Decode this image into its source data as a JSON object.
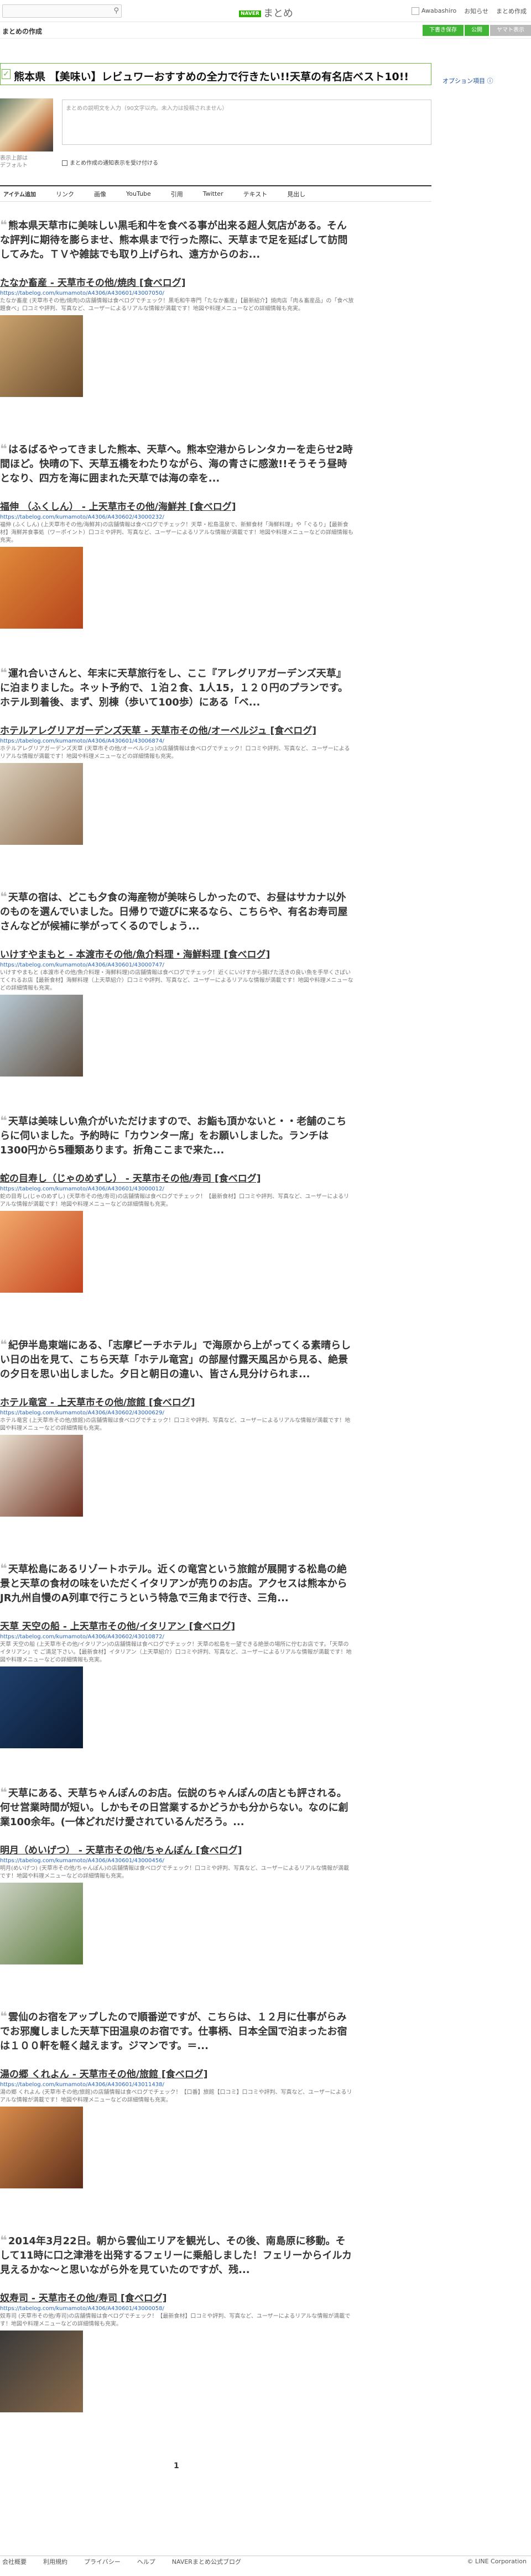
{
  "header": {
    "search_placeholder": "",
    "logo_naver": "NAVER",
    "logo_text": "まとめ",
    "user_name": "Awabashiro",
    "notices": "お知らせ",
    "matome_menu": "まとめ作成"
  },
  "subbar": {
    "title": "まとめの作成",
    "buttons": [
      "下書き保存",
      "公開",
      "ヤマト表示"
    ]
  },
  "matome": {
    "check": "✓",
    "title": "熊本県 【美味い】レビュワーおすすめの全力で行きたい!!天草の有名店ベスト10!!",
    "option": "オプション項目 ⓘ",
    "thumb_caption": [
      "表示上部は",
      "デフォルト"
    ],
    "comment_placeholder": "まとめの説明文を入力（90文字以内。未入力は投稿されません）",
    "notify_label": "まとめ作成の通知表示を受け付ける"
  },
  "add_bar": [
    "アイテム追加",
    "リンク",
    "画像",
    "YouTube",
    "引用",
    "Twitter",
    "テキスト",
    "見出し"
  ],
  "items": [
    {
      "quote": "熊本県天草市に美味しい黒毛和牛を食べる事が出来る超人気店がある。そんな評判に期待を膨らませ、熊本県まで行った際に、天草まで足を延ばして訪問してみた。ＴＶや雑誌でも取り上げられ、遠方からのお...",
      "title": "たなか畜産 - 天草市その他/焼肉 [食べログ]",
      "url": "https://tabelog.com/kumamoto/A4306/A430601/43007050/",
      "desc": "たなか畜産 (天草市その他/焼肉)の店舗情報は食べログでチェック！黒毛和牛専門「たなか畜産」【最新紹介】焼肉店「肉＆畜産品」の「食べ放題食べ」口コミや評判、写真など、ユーザーによるリアルな情報が満載です！地図や料理メニューなどの詳細情報も充実。",
      "photo": [
        "#c9a26d",
        "#6b4b2c"
      ]
    },
    {
      "quote": "はるばるやってきました熊本、天草へ。熊本空港からレンタカーを走らせ2時間ほど。快晴の下、天草五橋をわたりながら、海の青さに感激!!そうそう昼時となり、四方を海に囲まれた天草では海の幸を...",
      "title": "福伸 （ふくしん） - 上天草市その他/海鮮丼 [食べログ]",
      "url": "https://tabelog.com/kumamoto/A4306/A430602/43000232/",
      "desc": "福伸 (ふくしん) (上天草市その他/海鮮丼)の店舗情報は食べログでチェック！天草・松島温泉で、新鮮食材「海鮮料理」や「ぐるり」【最新食材】海鮮丼食事処（ワーポイント）口コミや評判、写真など、ユーザーによるリアルな情報が満載です！地図や料理メニューなどの詳細情報も充実。",
      "photo": [
        "#e08a3a",
        "#b5441c"
      ]
    },
    {
      "quote": "運れ合いさんと、年末に天草旅行をし、ここ『アレグリアガーデンズ天草』に泊まりました。ネット予約で、１泊２食、1人15，１２０円のプランです。ホテル到着後、まず、別棟（歩いて100歩）にある「ベ...",
      "title": "ホテルアレグリアガーデンズ天草 - 天草市その他/オーベルジュ [食べログ]",
      "url": "https://tabelog.com/kumamoto/A4306/A430601/43006874/",
      "desc": "ホテルアレグリアガーデンズ天草 (天草市その他/オーベルジュ)の店舗情報は食べログでチェック！口コミや評判、写真など、ユーザーによるリアルな情報が満載です！地図や料理メニューなどの詳細情報も充実。",
      "photo": [
        "#d8ccb8",
        "#8c6a4c"
      ]
    },
    {
      "quote": "天草の宿は、どこも夕食の海産物が美味らしかったので、お昼はサカナ以外のものを選んでいました。日帰りで遊びに来るなら、こちらや、有名お寿司屋さんなどが候補に挙がってくるのでしょう...",
      "title": "いけすやまもと - 本渡市その他/魚介料理・海鮮料理 [食べログ]",
      "url": "https://tabelog.com/kumamoto/A4306/A430601/43000747/",
      "desc": "いけすやまもと (本渡市その他/魚介料理・海鮮料理)の店舗情報は食べログでチェック！近くにいけすから揚げた活きの良い魚を手早くさばいてくれるお店【最新食材】海鮮料理（上天草紹介）口コミや評判、写真など、ユーザーによるリアルな情報が満載です！地図や料理メニューなどの詳細情報も充実。",
      "photo": [
        "#b7c9d4",
        "#5c4a3a"
      ]
    },
    {
      "quote": "天草は美味しい魚介がいただけますので、お鮨も頂かないと・・老舗のこちらに伺いました。予約時に「カウンター席」をお願いしました。ランチは1300円から5種類あります。折角ここまで来た...",
      "title": "蛇の目寿し（じゃのめずし） - 天草市その他/寿司 [食べログ]",
      "url": "https://tabelog.com/kumamoto/A4306/A430601/43000012/",
      "desc": "蛇の目寿し(じゃのめずし) (天草市その他/寿司)の店舗情報は食べログでチェック！【最新食材】口コミや評判、写真など、ユーザーによるリアルな情報が満載です！地図や料理メニューなどの詳細情報も充実。",
      "photo": [
        "#f2a86b",
        "#c2421e"
      ]
    },
    {
      "quote": "紀伊半島東端にある、「志摩ビーチホテル」で海原から上がってくる素晴らしい日の出を見て、こちら天草「ホテル竜宮」の部屋付露天風呂から見る、絶景の夕日を思い出しました。夕日と朝日の違い、皆さん見分けられま...",
      "title": "ホテル竜宮 - 上天草市その他/旅館 [食べログ]",
      "url": "https://tabelog.com/kumamoto/A4306/A430602/43000629/",
      "desc": "ホテル竜宮 (上天草市その他/旅館)の店舗情報は食べログでチェック！口コミや評判、写真など、ユーザーによるリアルな情報が満載です！地図や料理メニューなどの詳細情報も充実。",
      "photo": [
        "#e9dfcf",
        "#6d2f1f"
      ]
    },
    {
      "quote": "天草松島にあるリゾートホテル。近くの竜宮という旅館が展開する松島の絶景と天草の食材の味をいただくイタリアンが売りのお店。アクセスは熊本からJR九州自慢のA列車で行こうという特急で三角まで行き、三角...",
      "title": "天草 天空の船 - 上天草市その他/イタリアン [食べログ]",
      "url": "https://tabelog.com/kumamoto/A4306/A430602/43010872/",
      "desc": "天草 天空の船 (上天草市その他/イタリアン)の店舗情報は食べログでチェック！天草の松島を一望できる絶景の場所に佇むお店です。「天草のイタリアン」で ご満足下さい。【最新食材】イタリアン（上天草紹介）口コミや評判、写真など、ユーザーによるリアルな情報が満載です！地図や料理メニューなどの詳細情報も充実。",
      "photo": [
        "#1e3f6b",
        "#0b1b33"
      ]
    },
    {
      "quote": "天草にある、天草ちゃんぽんのお店。伝説のちゃんぽんの店とも評される。何せ営業時間が短い。しかもその日営業するかどうかも分からない。なのに創業100余年。(一体どれだけ愛されているんだろう。...",
      "title": "明月（めいげつ） - 天草市その他/ちゃんぽん [食べログ]",
      "url": "https://tabelog.com/kumamoto/A4306/A430601/43000456/",
      "desc": "明月(めいげつ) (天草市その他/ちゃんぽん)の店舗情報は食べログでチェック！口コミや評判、写真など、ユーザーによるリアルな情報が満載です！地図や料理メニューなどの詳細情報も充実。",
      "photo": [
        "#c8cfc0",
        "#5a7a3a"
      ]
    },
    {
      "quote": "雲仙のお宿をアップしたので順番逆ですが、こちらは、１２月に仕事がらみでお邪魔しました天草下田温泉のお宿です。仕事柄、日本全国で泊まったお宿は１００軒を軽く越えます。ジマンです。＝...",
      "title": "湯の郷 くれよん - 天草市その他/旅館 [食べログ]",
      "url": "https://tabelog.com/kumamoto/A4306/A430601/43011438/",
      "desc": "湯の郷 くれよん (天草市その他/旅館)の店舗情報は食べログでチェック！【口番】旅館【口コミ】口コミや評判、写真など、ユーザーによるリアルな情報が満載です！地図や料理メニューなどの詳細情報も充実。",
      "photo": [
        "#d88b4a",
        "#5b2e1a"
      ]
    },
    {
      "quote": "2014年3月22日。朝から雲仙エリアを観光し、その後、南島原に移動。そして11時に口之津港を出発するフェリーに乗船しました！フェリーからイルカ見えるかな〜と思いながら外を見ていたのですが、残...",
      "title": "奴寿司 - 天草市その他/寿司 [食べログ]",
      "url": "https://tabelog.com/kumamoto/A4306/A430601/43000058/",
      "desc": "奴寿司 (天草市その他/寿司)の店舗情報は食べログでチェック！【最新食材】口コミや評判、写真など、ユーザーによるリアルな情報が満載です！地図や料理メニューなどの詳細情報も充実。",
      "photo": [
        "#3a3a3a",
        "#8a6a4a"
      ]
    }
  ],
  "pager": "1",
  "footer": {
    "links": [
      "会社概要",
      "利用規約",
      "プライバシー",
      "ヘルプ",
      "NAVERまとめ公式ブログ"
    ],
    "copyright": "© LINE Corporation"
  }
}
